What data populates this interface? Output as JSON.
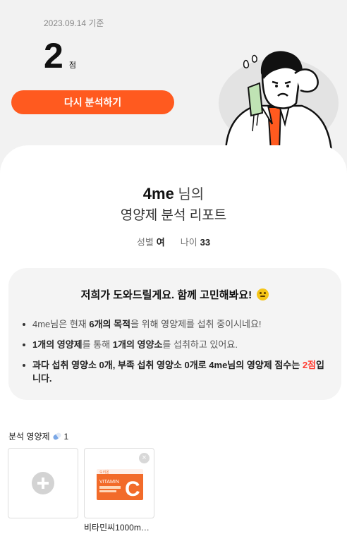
{
  "header": {
    "date": "2023.09.14 기준",
    "score": "2",
    "score_unit": "점",
    "reanalyze_label": "다시 분석하기"
  },
  "report": {
    "user": "4me",
    "title_suffix": " 님의",
    "title_line2": "영양제 분석 리포트",
    "gender_label": "성별",
    "gender_value": "여",
    "age_label": "나이",
    "age_value": "33"
  },
  "help": {
    "title": "저희가 도와드릴게요. 함께 고민해봐요!",
    "bullet1": {
      "a": "4me님은 현재 ",
      "b": "6개의 목적",
      "c": "을 위해 영양제를 섭취 중이시네요!"
    },
    "bullet2": {
      "a": "1개의 영양제",
      "b": "를 통해 ",
      "c": "1개의 영양소",
      "d": "를 섭취하고 있어요."
    },
    "bullet3": {
      "a": "과다 섭취 영양소 0개, 부족 섭취 영양소 0개로 4me님의 영양제 점수는 ",
      "b": "2점",
      "c": "입니다."
    }
  },
  "supplements": {
    "label": "분석 영양제",
    "count": "1",
    "items": [
      {
        "name": "비타민씨1000m…",
        "package_brand": "오리온",
        "package_text": "VITAMIN",
        "package_letter": "C"
      }
    ],
    "remove_glyph": "×"
  },
  "colors": {
    "accent": "#ff5a1f",
    "score_red": "#ff3b30"
  },
  "icons": {
    "help_emoji": "thinking-face-icon",
    "supplement": "pill-icon",
    "add": "plus-circle-icon",
    "remove": "close-icon"
  }
}
